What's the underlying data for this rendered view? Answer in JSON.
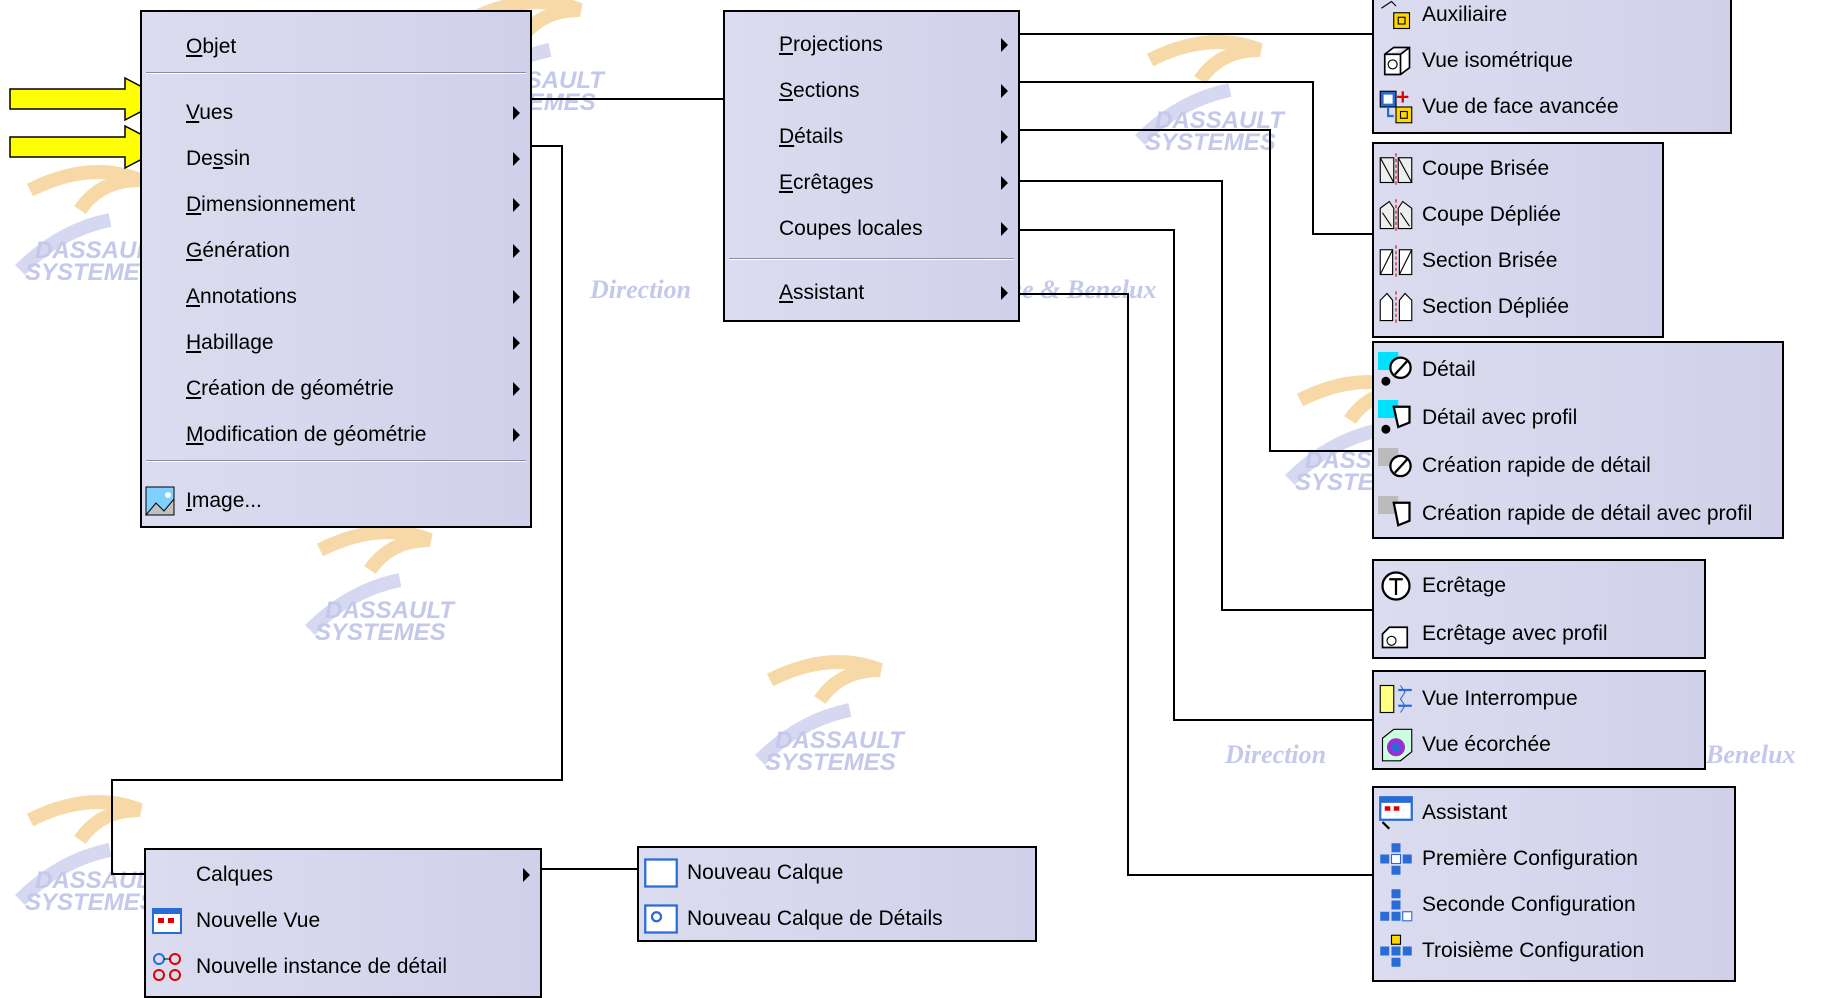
{
  "watermark": {
    "company_top": "DASSAULT",
    "company_bottom": "SYSTEMES",
    "direction_left": "Direction",
    "direction_right": "se & Benelux",
    "direction_left2": "Direction",
    "direction_right2": "Benelux"
  },
  "main_menu": {
    "items": [
      {
        "label": "Objet",
        "u": "O"
      },
      {
        "label": "Vues",
        "u": "V"
      },
      {
        "label": "Dessin",
        "u": "s"
      },
      {
        "label": "Dimensionnement",
        "u": "D"
      },
      {
        "label": "Génération",
        "u": "G"
      },
      {
        "label": "Annotations",
        "u": "A"
      },
      {
        "label": "Habillage",
        "u": "H"
      },
      {
        "label": "Création de géométrie",
        "u": "C"
      },
      {
        "label": "Modification de géométrie",
        "u": "M"
      },
      {
        "label": "Image...",
        "u": "I"
      }
    ]
  },
  "vues_menu": {
    "items": [
      {
        "label": "Projections",
        "u": "P"
      },
      {
        "label": "Sections",
        "u": "S"
      },
      {
        "label": "Détails",
        "u": "D"
      },
      {
        "label": "Ecrêtages",
        "u": "E"
      },
      {
        "label": "Coupes locales",
        "u": ""
      },
      {
        "label": "Assistant",
        "u": "A"
      }
    ]
  },
  "projections_tb": [
    {
      "label": "Auxiliaire",
      "icon": "auxiliary-view-icon"
    },
    {
      "label": "Vue isométrique",
      "icon": "isometric-view-icon"
    },
    {
      "label": "Vue de face avancée",
      "icon": "advanced-front-view-icon"
    }
  ],
  "sections_tb": [
    {
      "label": "Coupe Brisée",
      "icon": "offset-section-view-icon"
    },
    {
      "label": "Coupe Dépliée",
      "icon": "aligned-section-view-icon"
    },
    {
      "label": "Section Brisée",
      "icon": "offset-section-cut-icon"
    },
    {
      "label": "Section Dépliée",
      "icon": "aligned-section-cut-icon"
    }
  ],
  "details_tb": [
    {
      "label": "Détail",
      "icon": "detail-view-icon"
    },
    {
      "label": "Détail avec profil",
      "icon": "detail-view-profile-icon"
    },
    {
      "label": "Création rapide de détail",
      "icon": "quick-detail-view-icon"
    },
    {
      "label": "Création rapide de détail avec profil",
      "icon": "quick-detail-view-profile-icon"
    }
  ],
  "ecretages_tb": [
    {
      "label": "Ecrêtage",
      "icon": "clipping-view-icon"
    },
    {
      "label": "Ecrêtage avec profil",
      "icon": "clipping-view-profile-icon"
    }
  ],
  "coupes_tb": [
    {
      "label": "Vue Interrompue",
      "icon": "broken-view-icon"
    },
    {
      "label": "Vue écorchée",
      "icon": "breakout-view-icon"
    }
  ],
  "assistant_tb": [
    {
      "label": "Assistant",
      "icon": "view-wizard-icon"
    },
    {
      "label": "Première Configuration",
      "icon": "first-configuration-icon"
    },
    {
      "label": "Seconde Configuration",
      "icon": "second-configuration-icon"
    },
    {
      "label": "Troisième Configuration",
      "icon": "third-configuration-icon"
    }
  ],
  "dessin_menu": [
    {
      "label": "Calques",
      "icon": ""
    },
    {
      "label": "Nouvelle Vue",
      "icon": "new-view-icon"
    },
    {
      "label": "Nouvelle instance de détail",
      "icon": "new-detail-instance-icon"
    }
  ],
  "calques_tb": [
    {
      "label": "Nouveau Calque",
      "icon": "new-sheet-icon"
    },
    {
      "label": "Nouveau Calque de Détails",
      "icon": "new-detail-sheet-icon"
    }
  ]
}
